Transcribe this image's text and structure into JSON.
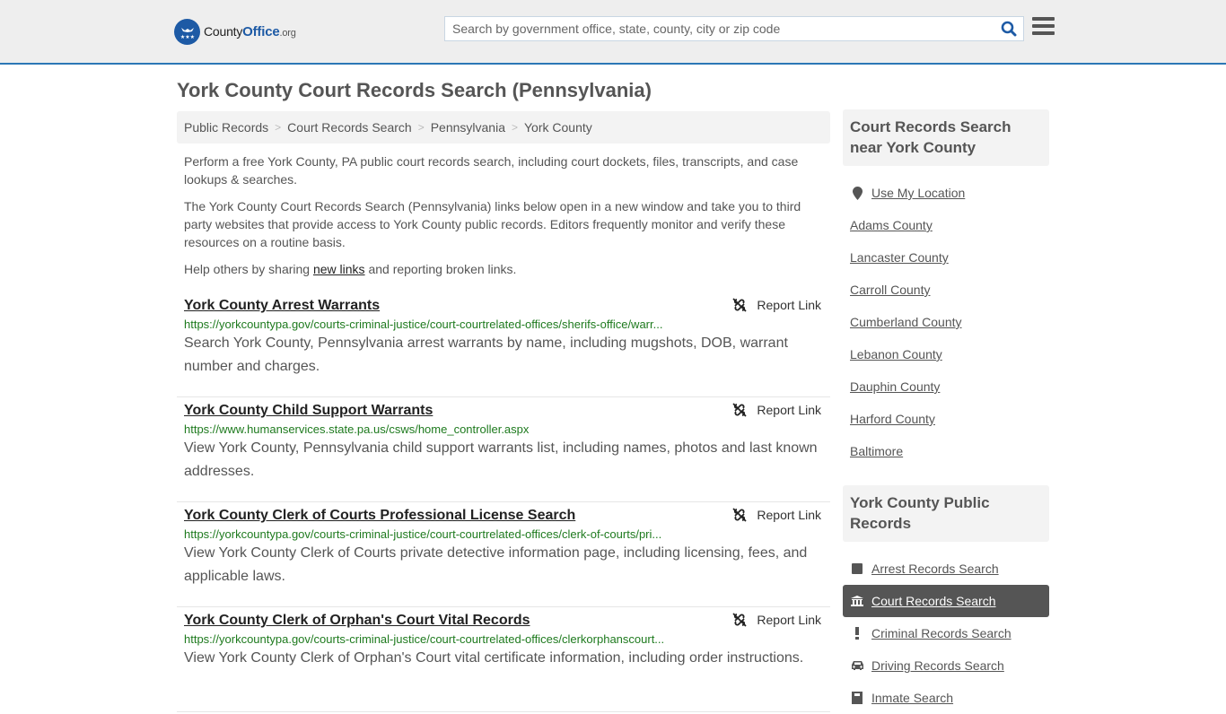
{
  "header": {
    "logo": {
      "name_part1": "County",
      "name_part2": "Office",
      "tld": ".org"
    },
    "search": {
      "placeholder": "Search by government office, state, county, city or zip code",
      "value": ""
    },
    "accent_color": "#2c77b6"
  },
  "page": {
    "title": "York County Court Records Search (Pennsylvania)",
    "breadcrumb": [
      "Public Records",
      "Court Records Search",
      "Pennsylvania",
      "York County"
    ],
    "intro": {
      "p1": "Perform a free York County, PA public court records search, including court dockets, files, transcripts, and case lookups & searches.",
      "p2": "The York County Court Records Search (Pennsylvania) links below open in a new window and take you to third party websites that provide access to York County public records. Editors frequently monitor and verify these resources on a routine basis.",
      "p3_before": "Help others by sharing ",
      "p3_link": "new links",
      "p3_after": " and reporting broken links."
    }
  },
  "results": [
    {
      "title": "York County Arrest Warrants",
      "url": "https://yorkcountypa.gov/courts-criminal-justice/court-courtrelated-offices/sherifs-office/warr...",
      "description": "Search York County, Pennsylvania arrest warrants by name, including mugshots, DOB, warrant number and charges.",
      "report_label": "Report Link"
    },
    {
      "title": "York County Child Support Warrants",
      "url": "https://www.humanservices.state.pa.us/csws/home_controller.aspx",
      "description": "View York County, Pennsylvania child support warrants list, including names, photos and last known addresses.",
      "report_label": "Report Link"
    },
    {
      "title": "York County Clerk of Courts Professional License Search",
      "url": "https://yorkcountypa.gov/courts-criminal-justice/court-courtrelated-offices/clerk-of-courts/pri...",
      "description": "View York County Clerk of Courts private detective information page, including licensing, fees, and applicable laws.",
      "report_label": "Report Link"
    },
    {
      "title": "York County Clerk of Orphan's Court Vital Records",
      "url": "https://yorkcountypa.gov/courts-criminal-justice/court-courtrelated-offices/clerkorphanscourt...",
      "description": "View York County Clerk of Orphan's Court vital certificate information, including order instructions.",
      "report_label": "Report Link"
    }
  ],
  "sidebar": {
    "nearby": {
      "heading": "Court Records Search near York County",
      "use_location": "Use My Location",
      "items": [
        "Adams County",
        "Lancaster County",
        "Carroll County",
        "Cumberland County",
        "Lebanon County",
        "Dauphin County",
        "Harford County",
        "Baltimore"
      ]
    },
    "public_records": {
      "heading": "York County Public Records",
      "items": [
        {
          "label": "Arrest Records Search",
          "icon": "square-icon",
          "active": false
        },
        {
          "label": "Court Records Search",
          "icon": "courthouse-icon",
          "active": true
        },
        {
          "label": "Criminal Records Search",
          "icon": "exclamation-icon",
          "active": false
        },
        {
          "label": "Driving Records Search",
          "icon": "car-icon",
          "active": false
        },
        {
          "label": "Inmate Search",
          "icon": "inmate-icon",
          "active": false
        }
      ]
    }
  }
}
